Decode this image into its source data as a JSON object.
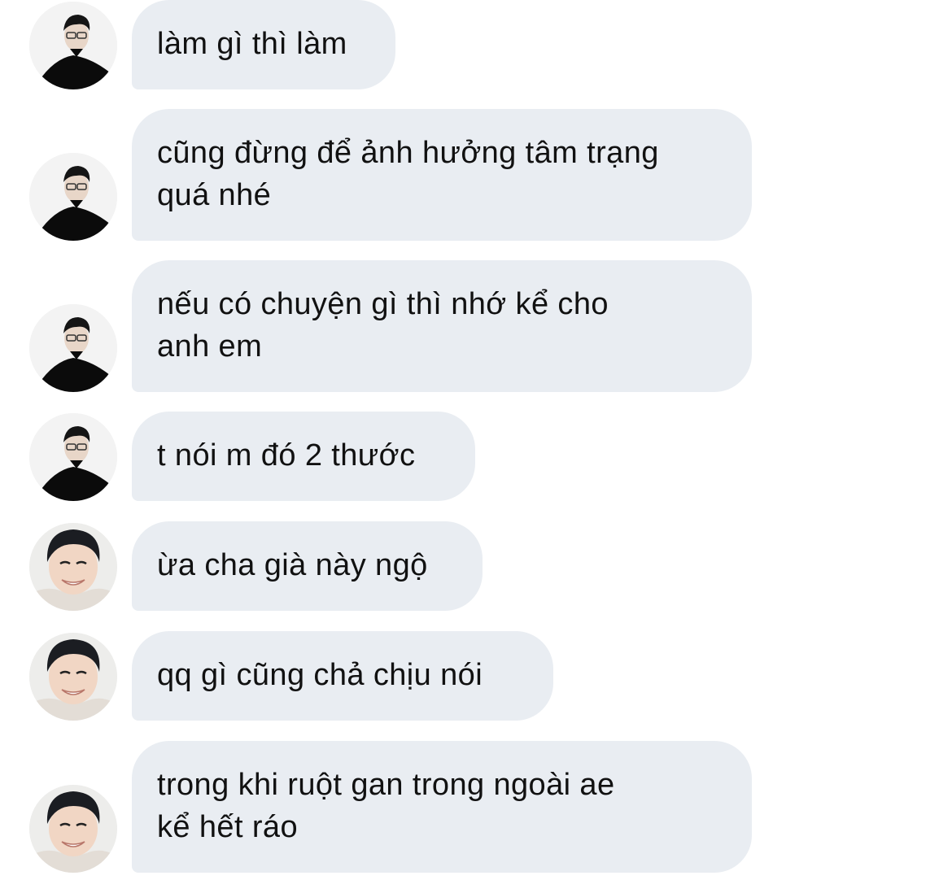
{
  "messages": [
    {
      "text": "làm gì thì làm",
      "sender": "friend-glasses"
    },
    {
      "text": "cũng đừng để ảnh hưởng tâm trạng\nquá nhé",
      "sender": "friend-glasses"
    },
    {
      "text": "nếu có chuyện gì thì nhớ kể cho\nanh em",
      "sender": "friend-glasses"
    },
    {
      "text": "t nói m đó 2 thước",
      "sender": "friend-glasses"
    },
    {
      "text": "ừa cha già này ngộ",
      "sender": "friend-smiling"
    },
    {
      "text": "qq gì cũng chả chịu nói",
      "sender": "friend-smiling"
    },
    {
      "text": "trong khi ruột gan trong ngoài ae\nkể hết ráo",
      "sender": "friend-smiling"
    }
  ],
  "colors": {
    "bubble_bg": "#e9edf2",
    "text": "#111111",
    "background": "#ffffff"
  }
}
